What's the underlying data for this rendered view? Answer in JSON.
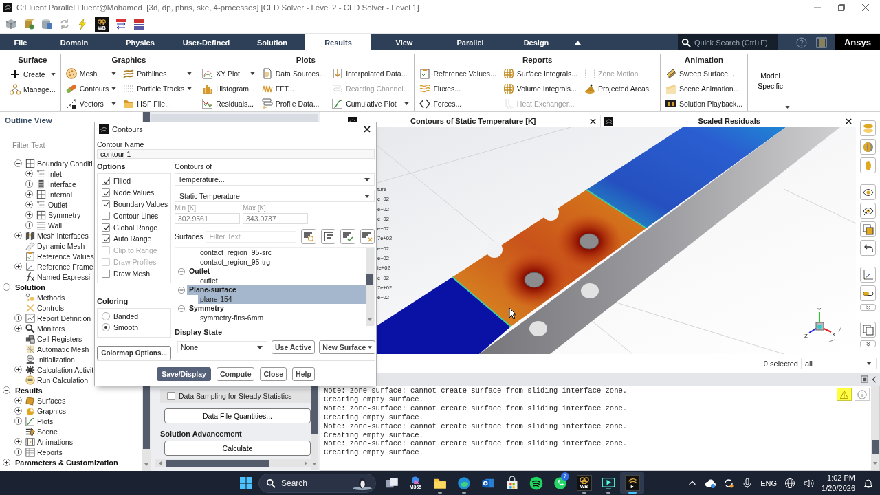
{
  "window": {
    "title": "C:Fluent Parallel Fluent@Mohamed  [3d, dp, pbns, ske, 4-processes] [CFD Solver - Level 2 - CFD Solver - Level 1]"
  },
  "quick_toolbar": {
    "workbench_label": "WB"
  },
  "ribbon_tabs": [
    {
      "label": "File",
      "selected": false
    },
    {
      "label": "Domain",
      "selected": false
    },
    {
      "label": "Physics",
      "selected": false
    },
    {
      "label": "User-Defined",
      "selected": false
    },
    {
      "label": "Solution",
      "selected": false
    },
    {
      "label": "Results",
      "selected": true
    },
    {
      "label": "View",
      "selected": false
    },
    {
      "label": "Parallel",
      "selected": false
    },
    {
      "label": "Design",
      "selected": false
    }
  ],
  "quick_search": {
    "placeholder": "Quick Search (Ctrl+F)"
  },
  "brand": "Ansys",
  "ribbon_groups": [
    {
      "title": "Surface",
      "columns": [
        [
          {
            "label": "Create",
            "dropdown": true,
            "disabled": false
          },
          {
            "label": "Manage...",
            "dropdown": false,
            "disabled": false
          }
        ]
      ]
    },
    {
      "title": "Graphics",
      "columns": [
        [
          {
            "label": "Mesh",
            "dropdown": true,
            "disabled": false
          },
          {
            "label": "Contours",
            "dropdown": true,
            "disabled": false
          },
          {
            "label": "Vectors",
            "dropdown": true,
            "disabled": false
          }
        ],
        [
          {
            "label": "Pathlines",
            "dropdown": true,
            "disabled": false
          },
          {
            "label": "Particle Tracks",
            "dropdown": true,
            "disabled": false
          },
          {
            "label": "HSF File...",
            "dropdown": false,
            "disabled": false
          }
        ]
      ]
    },
    {
      "title": "Plots",
      "columns": [
        [
          {
            "label": "XY Plot",
            "dropdown": true,
            "disabled": false
          },
          {
            "label": "Histogram...",
            "dropdown": false,
            "disabled": false
          },
          {
            "label": "Residuals...",
            "dropdown": false,
            "disabled": false
          }
        ],
        [
          {
            "label": "Data Sources...",
            "dropdown": false,
            "disabled": false
          },
          {
            "label": "FFT...",
            "dropdown": false,
            "disabled": false
          },
          {
            "label": "Profile Data...",
            "dropdown": false,
            "disabled": false
          }
        ],
        [
          {
            "label": "Interpolated Data...",
            "dropdown": false,
            "disabled": false
          },
          {
            "label": "Reacting Channel...",
            "dropdown": false,
            "disabled": true
          },
          {
            "label": "Cumulative Plot",
            "dropdown": true,
            "disabled": false
          }
        ]
      ]
    },
    {
      "title": "Reports",
      "columns": [
        [
          {
            "label": "Reference Values...",
            "dropdown": false,
            "disabled": false
          },
          {
            "label": "Fluxes...",
            "dropdown": false,
            "disabled": false
          },
          {
            "label": "Forces...",
            "dropdown": false,
            "disabled": false
          }
        ],
        [
          {
            "label": "Surface Integrals...",
            "dropdown": false,
            "disabled": false
          },
          {
            "label": "Volume Integrals...",
            "dropdown": false,
            "disabled": false
          },
          {
            "label": "Heat Exchanger...",
            "dropdown": false,
            "disabled": true
          }
        ],
        [
          {
            "label": "Zone Motion...",
            "dropdown": false,
            "disabled": true
          },
          {
            "label": "Projected Areas...",
            "dropdown": false,
            "disabled": false
          }
        ]
      ]
    },
    {
      "title": "Animation",
      "columns": [
        [
          {
            "label": "Sweep Surface...",
            "dropdown": false,
            "disabled": false
          },
          {
            "label": "Scene Animation...",
            "dropdown": false,
            "disabled": false
          },
          {
            "label": "Solution Playback...",
            "dropdown": false,
            "disabled": false
          }
        ]
      ]
    }
  ],
  "model_specific": {
    "label": "Model Specific"
  },
  "outline": {
    "title": "Outline View",
    "filter_placeholder": "Filter Text",
    "setup_items": [
      {
        "label": "Boundary Conditi",
        "expanded": true,
        "children": [
          {
            "label": "Inlet",
            "expanded": false
          },
          {
            "label": "Interface",
            "expanded": false
          },
          {
            "label": "Internal",
            "expanded": false
          },
          {
            "label": "Outlet",
            "expanded": false
          },
          {
            "label": "Symmetry",
            "expanded": false
          },
          {
            "label": "Wall",
            "expanded": false
          }
        ]
      },
      {
        "label": "Mesh Interfaces",
        "expanded": false
      },
      {
        "label": "Dynamic Mesh"
      },
      {
        "label": "Reference Values"
      },
      {
        "label": "Reference Frame",
        "expanded": false
      },
      {
        "label": "Named Expressi"
      }
    ],
    "sections": [
      {
        "label": "Solution",
        "expanded": true,
        "children": [
          {
            "label": "Methods"
          },
          {
            "label": "Controls"
          },
          {
            "label": "Report Definition",
            "expanded": false
          },
          {
            "label": "Monitors",
            "expanded": false
          },
          {
            "label": "Cell Registers"
          },
          {
            "label": "Automatic Mesh"
          },
          {
            "label": "Initialization"
          },
          {
            "label": "Calculation Activit",
            "expanded": false
          },
          {
            "label": "Run Calculation"
          }
        ]
      },
      {
        "label": "Results",
        "expanded": true,
        "children": [
          {
            "label": "Surfaces",
            "expanded": false
          },
          {
            "label": "Graphics",
            "expanded": false
          },
          {
            "label": "Plots",
            "expanded": false
          },
          {
            "label": "Scene"
          },
          {
            "label": "Animations",
            "expanded": false
          },
          {
            "label": "Reports",
            "expanded": false
          }
        ]
      },
      {
        "label": "Parameters & Customization",
        "expanded": false
      }
    ]
  },
  "task_page": {
    "checkbox": {
      "label": "Data Sampling for Steady Statistics",
      "checked": false
    },
    "quantities_button": "Data File Quantities...",
    "section_title": "Solution Advancement",
    "calculate_button": "Calculate"
  },
  "graphics_tabs": [
    {
      "title": "Contours of Static Temperature [K]"
    },
    {
      "title": "Scaled Residuals"
    }
  ],
  "legend_fragments": [
    "ture",
    "e+02",
    "e+02",
    "e+02",
    "e+02",
    "7e+02",
    "e+02",
    "e+02",
    "ie+02",
    "e+02",
    "7e+02",
    "e+02"
  ],
  "triad_axes": [
    "Y",
    "X",
    "Z"
  ],
  "selection": {
    "count": "0 selected",
    "filter": "all"
  },
  "console": {
    "lines": [
      "Note: zone-surface: cannot create surface from sliding interface zone.",
      "Creating empty surface.",
      "Note: zone-surface: cannot create surface from sliding interface zone.",
      "Creating empty surface.",
      "Note: zone-surface: cannot create surface from sliding interface zone.",
      "Creating empty surface.",
      "Note: zone-surface: cannot create surface from sliding interface zone.",
      "Creating empty surface."
    ]
  },
  "contours_dialog": {
    "title": "Contours",
    "name_label": "Contour Name",
    "name_value": "contour-1",
    "options_title": "Options",
    "options": [
      {
        "label": "Filled",
        "checked": true,
        "disabled": false
      },
      {
        "label": "Node Values",
        "checked": true,
        "disabled": false
      },
      {
        "label": "Boundary Values",
        "checked": true,
        "disabled": false
      },
      {
        "label": "Contour Lines",
        "checked": false,
        "disabled": false
      },
      {
        "label": "Global Range",
        "checked": true,
        "disabled": false
      },
      {
        "label": "Auto Range",
        "checked": true,
        "disabled": false
      },
      {
        "label": "Clip to Range",
        "checked": false,
        "disabled": true
      },
      {
        "label": "Draw Profiles",
        "checked": false,
        "disabled": true
      },
      {
        "label": "Draw Mesh",
        "checked": false,
        "disabled": false
      }
    ],
    "coloring_title": "Coloring",
    "coloring": [
      {
        "label": "Banded",
        "selected": false
      },
      {
        "label": "Smooth",
        "selected": true
      }
    ],
    "colormap_button": "Colormap Options...",
    "contours_of_label": "Contours of",
    "field": "Temperature...",
    "subfield": "Static Temperature",
    "min_label": "Min [K]",
    "min_value": "302.9561",
    "max_label": "Max [K]",
    "max_value": "343.0737",
    "surfaces_label": "Surfaces",
    "surfaces_filter_placeholder": "Filter Text",
    "surfaces": {
      "top_items": [
        {
          "label": "contact_region_95-src",
          "selected": false
        },
        {
          "label": "contact_region_95-trg",
          "selected": false
        }
      ],
      "groups": [
        {
          "label": "Outlet",
          "expanded": true,
          "selected": false,
          "children": [
            {
              "label": "outlet",
              "selected": false
            }
          ]
        },
        {
          "label": "Plane-surface",
          "expanded": true,
          "selected": true,
          "children": [
            {
              "label": "plane-154",
              "selected": true
            }
          ]
        },
        {
          "label": "Symmetry",
          "expanded": true,
          "selected": false,
          "children": [
            {
              "label": "symmetry-fins-6mm",
              "selected": false
            }
          ]
        }
      ]
    },
    "display_state_label": "Display State",
    "display_state": "None",
    "use_active_button": "Use Active",
    "new_surface_button": "New Surface",
    "buttons": [
      {
        "label": "Save/Display",
        "kind": "primary"
      },
      {
        "label": "Compute",
        "kind": "normal"
      },
      {
        "label": "Close",
        "kind": "normal"
      },
      {
        "label": "Help",
        "kind": "normal"
      }
    ]
  },
  "taskbar": {
    "search_label": "Search",
    "apps": [
      {
        "kind": "task-view",
        "running": false,
        "active": false
      },
      {
        "kind": "m365",
        "label": "M365",
        "running": false,
        "active": false
      },
      {
        "kind": "explorer",
        "running": true,
        "active": false
      },
      {
        "kind": "edge",
        "running": true,
        "active": false
      },
      {
        "kind": "outlook",
        "running": false,
        "active": false
      },
      {
        "kind": "store",
        "running": false,
        "active": false
      },
      {
        "kind": "spotify",
        "running": false,
        "active": false
      },
      {
        "kind": "whatsapp",
        "badge": "7",
        "running": false,
        "active": false
      },
      {
        "kind": "workbench",
        "label": "WB",
        "running": true,
        "active": false
      },
      {
        "kind": "recorder",
        "running": true,
        "active": false
      },
      {
        "kind": "fluent",
        "label": "F",
        "running": true,
        "active": true
      }
    ],
    "tray": {
      "language": "ENG",
      "time": "1:02 PM",
      "date": "1/20/2026"
    }
  }
}
